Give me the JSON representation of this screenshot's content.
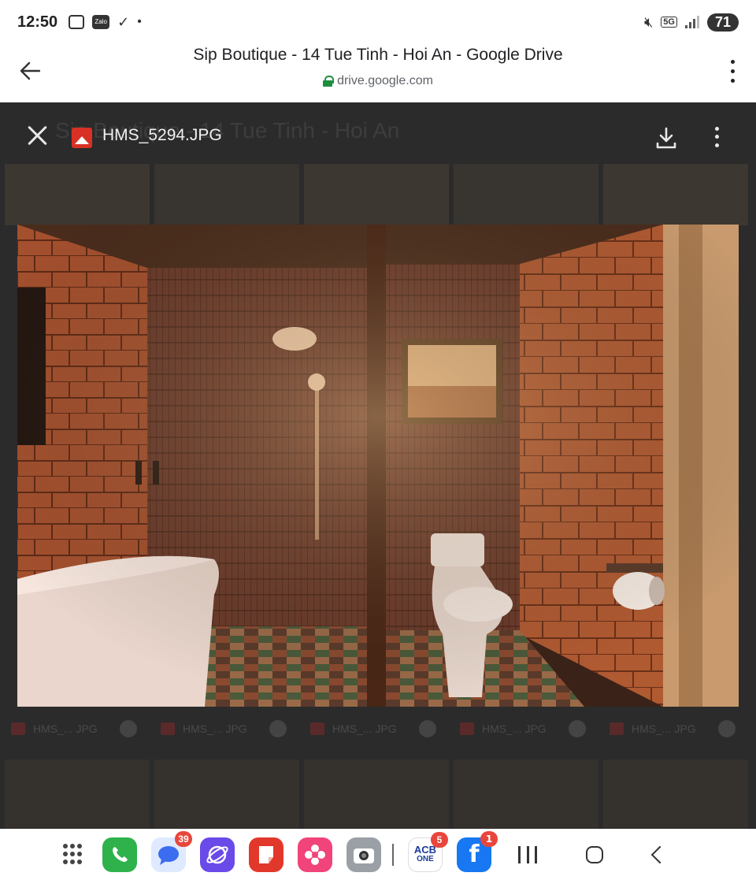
{
  "status_bar": {
    "time": "12:50",
    "zalo_label": "Zalo",
    "network": "5G",
    "battery": "71"
  },
  "header": {
    "title": "Sip Boutique - 14 Tue Tinh - Hoi An - Google Drive",
    "url": "drive.google.com"
  },
  "viewer": {
    "background_title": "Sip Boutique - 14 Tue Tinh - Hoi An",
    "file_name": "HMS_5294.JPG",
    "thumb_labels": [
      "HMS_... JPG",
      "HMS_... JPG",
      "HMS_... JPG",
      "HMS_... JPG",
      "HMS_... JPG"
    ]
  },
  "taskbar": {
    "apps": [
      {
        "name": "phone",
        "badge": ""
      },
      {
        "name": "messages",
        "badge": "39"
      },
      {
        "name": "internet",
        "badge": ""
      },
      {
        "name": "notes",
        "badge": ""
      },
      {
        "name": "gallery",
        "badge": ""
      },
      {
        "name": "camera",
        "badge": ""
      },
      {
        "name": "acb-one",
        "label_top": "ACB",
        "label_bottom": "ONE",
        "badge": "5"
      },
      {
        "name": "facebook",
        "label": "f",
        "badge": "1"
      }
    ]
  },
  "icons": [
    "back-arrow-icon",
    "lock-icon",
    "more-vert-icon",
    "close-icon",
    "image-file-icon",
    "download-icon",
    "apps-grid-icon",
    "recents-icon",
    "home-icon",
    "nav-back-icon"
  ],
  "colors": {
    "drive_viewer_bg": "#2b2b2b",
    "lock_green": "#1e8e3e",
    "file_icon_red": "#d93025",
    "badge_red": "#e8463c",
    "facebook_blue": "#1877f2"
  }
}
